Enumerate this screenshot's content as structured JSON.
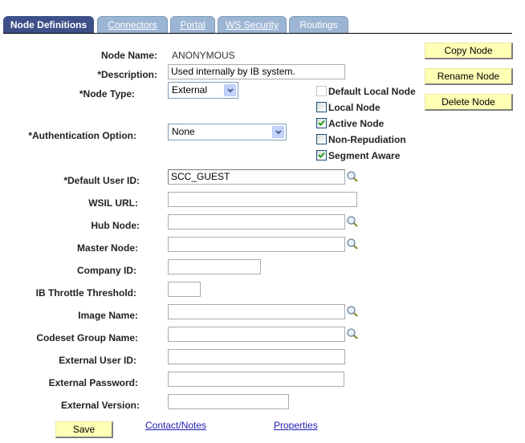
{
  "tabs": [
    {
      "label": "Node Definitions",
      "active": true
    },
    {
      "label": "Connectors",
      "active": false
    },
    {
      "label": "Portal",
      "active": false
    },
    {
      "label": "WS Security",
      "active": false
    },
    {
      "label": "Routings",
      "active": false
    }
  ],
  "form": {
    "node_name": {
      "label": "Node Name:",
      "value": "ANONYMOUS"
    },
    "description": {
      "label": "*Description:",
      "value": "Used internally by IB system."
    },
    "node_type": {
      "label": "*Node Type:",
      "value": "External"
    },
    "authentication_option": {
      "label": "*Authentication Option:",
      "value": "None"
    },
    "default_user_id": {
      "label": "*Default User ID:",
      "value": "SCC_GUEST"
    },
    "wsil_url": {
      "label": "WSIL URL:",
      "value": ""
    },
    "hub_node": {
      "label": "Hub Node:",
      "value": ""
    },
    "master_node": {
      "label": "Master Node:",
      "value": ""
    },
    "company_id": {
      "label": "Company ID:",
      "value": ""
    },
    "ib_throttle_threshold": {
      "label": "IB Throttle Threshold:",
      "value": ""
    },
    "image_name": {
      "label": "Image Name:",
      "value": ""
    },
    "codeset_group_name": {
      "label": "Codeset Group Name:",
      "value": ""
    },
    "external_user_id": {
      "label": "External User ID:",
      "value": ""
    },
    "external_password": {
      "label": "External Password:",
      "value": ""
    },
    "external_version": {
      "label": "External Version:",
      "value": ""
    }
  },
  "checkboxes": [
    {
      "label": "Default Local Node",
      "checked": false,
      "disabled": true
    },
    {
      "label": "Local Node",
      "checked": false,
      "disabled": false
    },
    {
      "label": "Active Node",
      "checked": true,
      "disabled": false
    },
    {
      "label": "Non-Repudiation",
      "checked": false,
      "disabled": false
    },
    {
      "label": "Segment Aware",
      "checked": true,
      "disabled": false
    }
  ],
  "buttons": {
    "copy_node": "Copy Node",
    "rename_node": "Rename Node",
    "delete_node": "Delete Node",
    "save": "Save"
  },
  "links": {
    "contact_notes": "Contact/Notes",
    "properties": "Properties"
  },
  "icons": {
    "lookup": "magnifier-lookup-icon",
    "dropdown": "chevron-down-icon",
    "check": "checkmark-icon"
  },
  "colors": {
    "active_tab": "#3e5089",
    "inactive_tab": "#9db5d4",
    "button_bg": "#ffffb5",
    "link": "#1e1eb4",
    "check": "#21a121"
  }
}
